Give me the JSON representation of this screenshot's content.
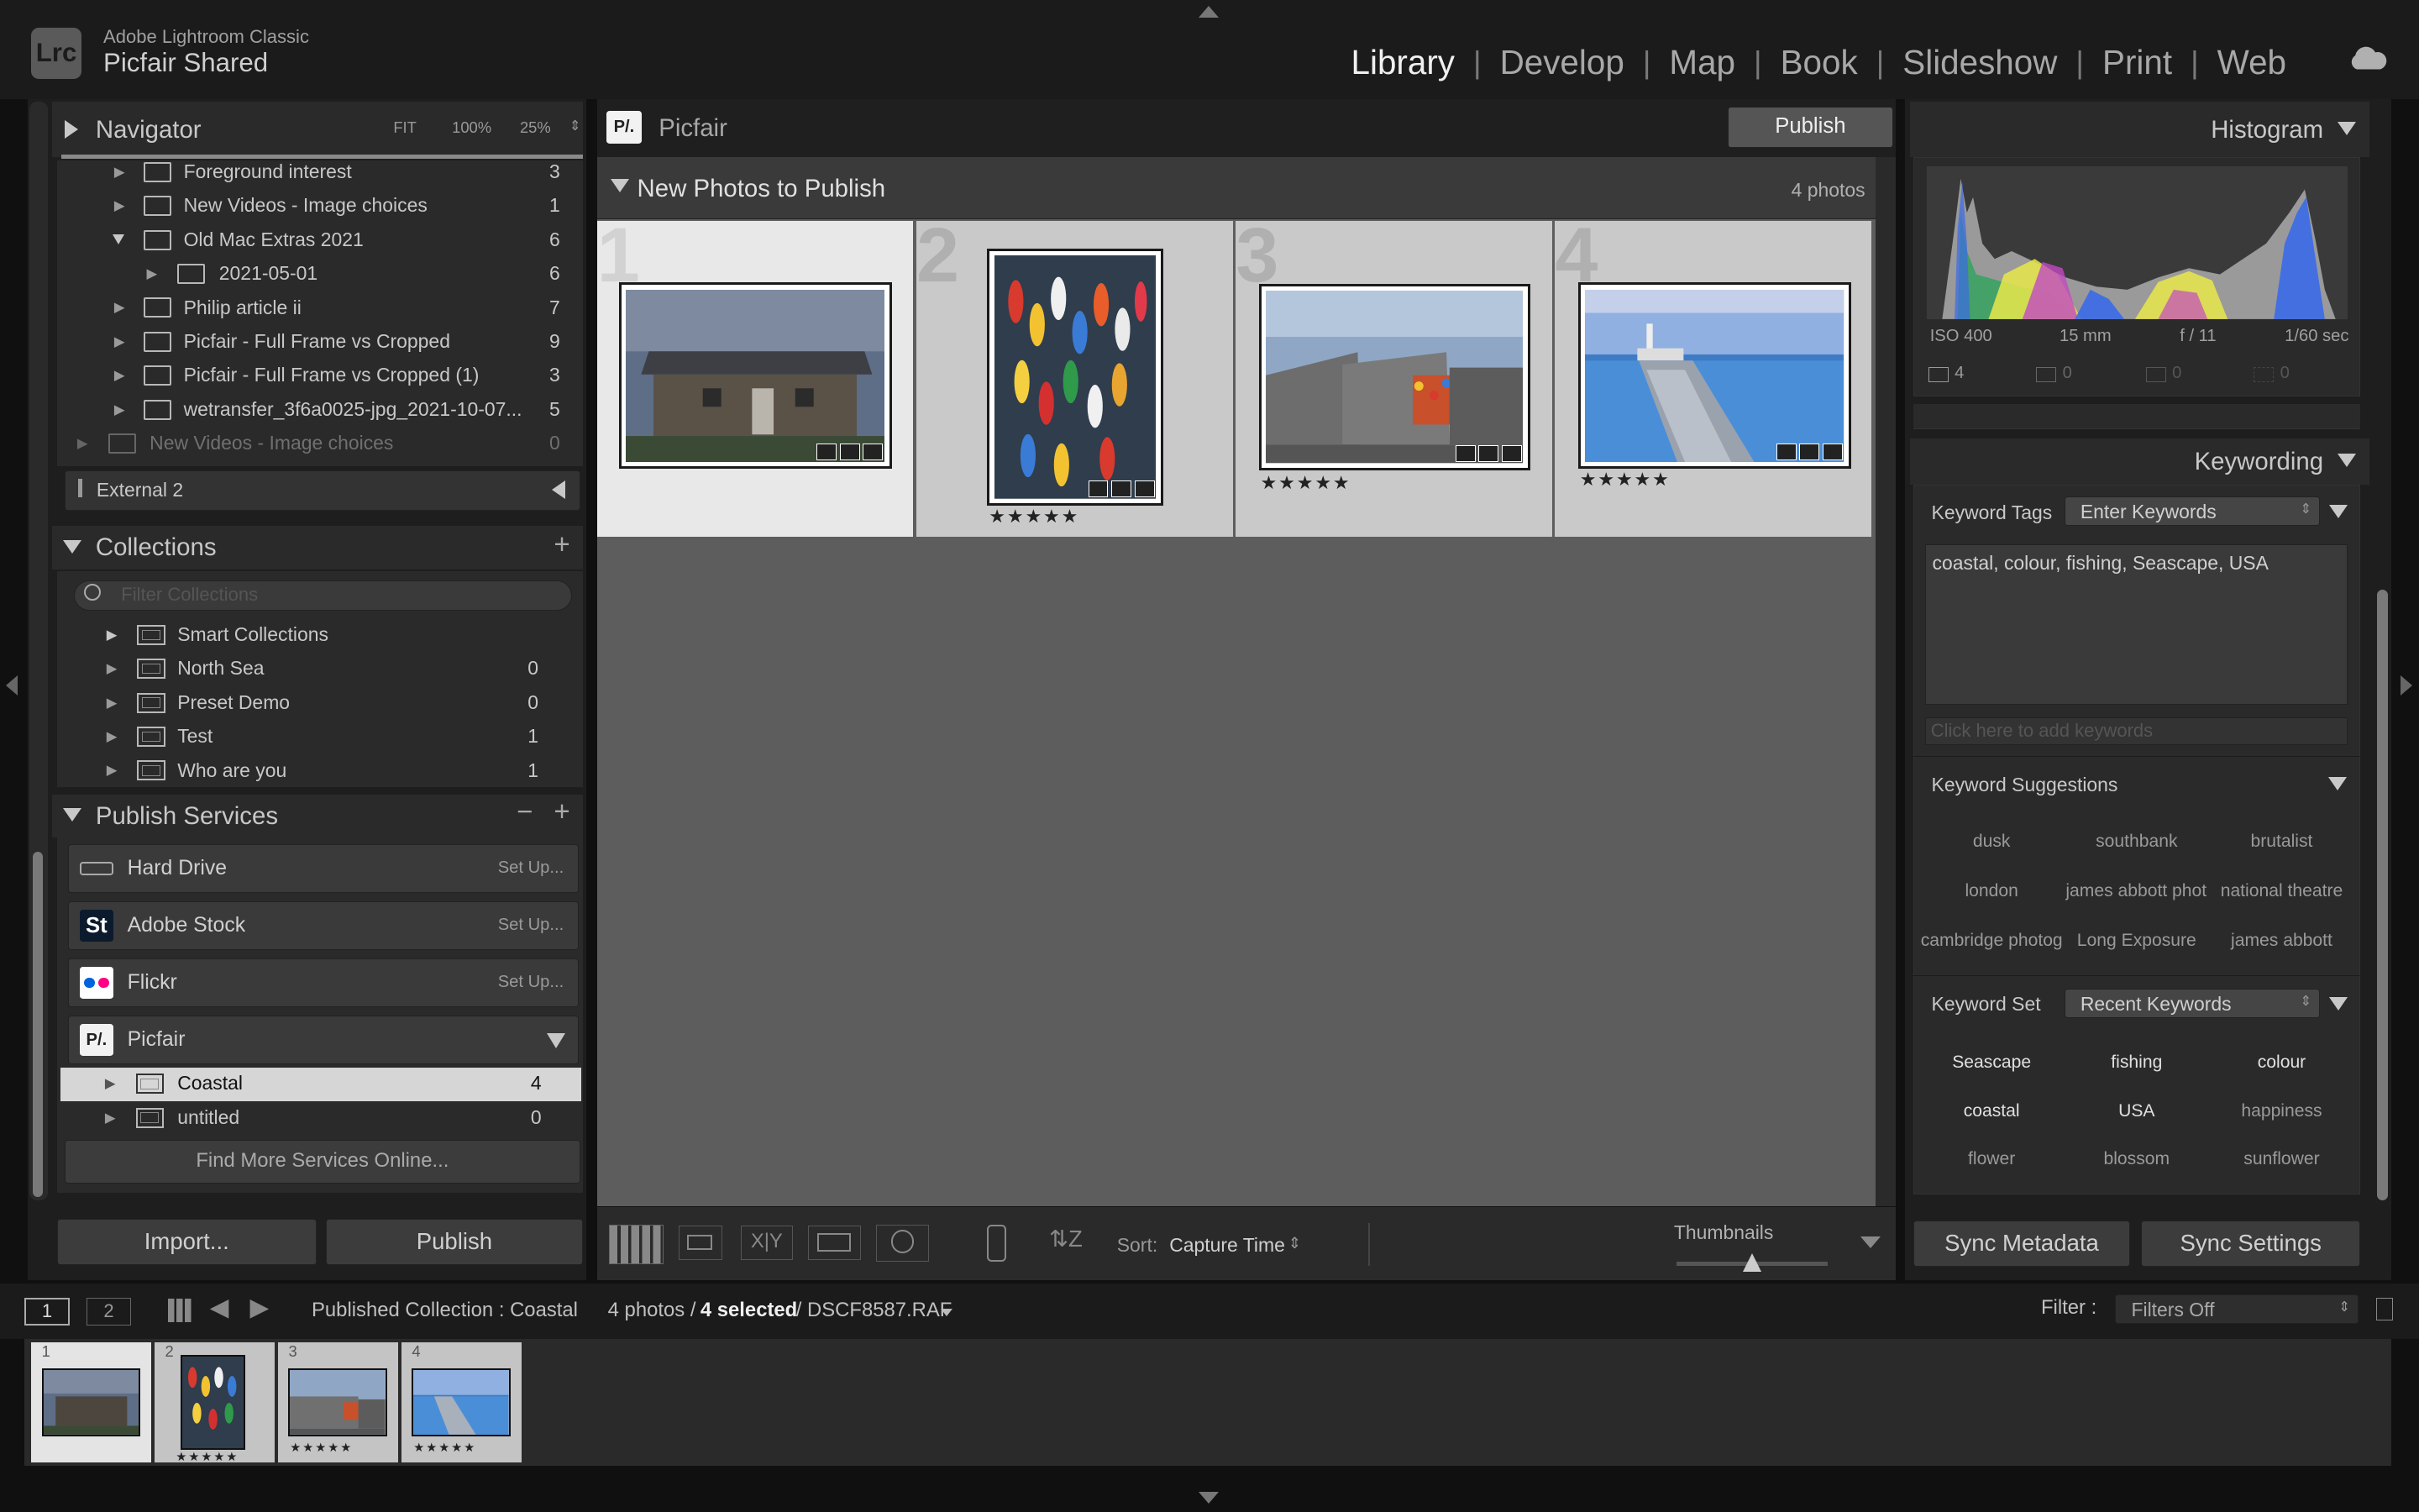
{
  "app": {
    "product": "Adobe Lightroom Classic",
    "catalog": "Picfair Shared",
    "logo": "Lrc"
  },
  "modules": [
    "Library",
    "Develop",
    "Map",
    "Book",
    "Slideshow",
    "Print",
    "Web"
  ],
  "active_module": "Library",
  "navigator": {
    "title": "Navigator",
    "zoom_options": [
      "FIT",
      "100%",
      "25%"
    ]
  },
  "folders": [
    {
      "name": "Foreground interest",
      "count": "3"
    },
    {
      "name": "New Videos - Image choices",
      "count": "1"
    },
    {
      "name": "Old Mac Extras 2021",
      "count": "6"
    },
    {
      "name": "2021-05-01",
      "count": "6"
    },
    {
      "name": "Philip article ii",
      "count": "7"
    },
    {
      "name": "Picfair - Full Frame vs Cropped",
      "count": "9"
    },
    {
      "name": "Picfair - Full Frame vs Cropped (1)",
      "count": "3"
    },
    {
      "name": "wetransfer_3f6a0025-jpg_2021-10-07...",
      "count": "5"
    },
    {
      "name": "New Videos - Image choices",
      "count": "0"
    }
  ],
  "volume": {
    "name": "External 2"
  },
  "collections": {
    "title": "Collections",
    "filter_placeholder": "Filter Collections",
    "items": [
      {
        "name": "Smart Collections",
        "count": ""
      },
      {
        "name": "North Sea",
        "count": "0"
      },
      {
        "name": "Preset Demo",
        "count": "0"
      },
      {
        "name": "Test",
        "count": "1"
      },
      {
        "name": "Who are you",
        "count": "1"
      }
    ]
  },
  "publish_services": {
    "title": "Publish Services",
    "minus": "−",
    "plus": "+",
    "services": [
      {
        "name": "Hard Drive",
        "action": "Set Up..."
      },
      {
        "name": "Adobe Stock",
        "action": "Set Up..."
      },
      {
        "name": "Flickr",
        "action": "Set Up..."
      },
      {
        "name": "Picfair",
        "action": ""
      }
    ],
    "picfair_collections": [
      {
        "name": "Coastal",
        "count": "4"
      },
      {
        "name": "untitled",
        "count": "0"
      }
    ],
    "find_more": "Find More Services Online..."
  },
  "left_buttons": {
    "import": "Import...",
    "publish": "Publish"
  },
  "center": {
    "service_title": "Picfair",
    "publish_button": "Publish",
    "section_title": "New Photos to Publish",
    "section_count": "4 photos",
    "cells": [
      {
        "num": "1",
        "stars": ""
      },
      {
        "num": "2",
        "stars": "★★★★★"
      },
      {
        "num": "3",
        "stars": "★★★★★"
      },
      {
        "num": "4",
        "stars": "★★★★★"
      }
    ]
  },
  "toolbar": {
    "sort_label": "Sort:",
    "sort_value": "Capture Time",
    "thumbnails_label": "Thumbnails",
    "thumbnail_slider": 0.5
  },
  "histogram": {
    "title": "Histogram",
    "iso": "ISO 400",
    "focal": "15 mm",
    "aperture": "f / 11",
    "shutter": "1/60 sec",
    "stats": [
      "4",
      "0",
      "0",
      "0"
    ]
  },
  "keywording": {
    "title": "Keywording",
    "tags_label": "Keyword Tags",
    "tags_mode": "Enter Keywords",
    "tags_text": "coastal, colour, fishing, Seascape, USA",
    "add_placeholder": "Click here to add keywords",
    "suggestions_title": "Keyword Suggestions",
    "suggestions": [
      "dusk",
      "southbank",
      "brutalist",
      "london",
      "james abbott phot...",
      "national theatre",
      "cambridge photog...",
      "Long Exposure",
      "james abbott"
    ],
    "set_label": "Keyword Set",
    "set_value": "Recent Keywords",
    "set_items": [
      {
        "name": "Seascape",
        "active": true
      },
      {
        "name": "fishing",
        "active": true
      },
      {
        "name": "colour",
        "active": true
      },
      {
        "name": "coastal",
        "active": true
      },
      {
        "name": "USA",
        "active": true
      },
      {
        "name": "happiness",
        "active": false
      },
      {
        "name": "flower",
        "active": false
      },
      {
        "name": "blossom",
        "active": false
      },
      {
        "name": "sunflower",
        "active": false
      }
    ]
  },
  "right_buttons": {
    "sync_metadata": "Sync Metadata",
    "sync_settings": "Sync Settings"
  },
  "filmstrip_bar": {
    "screen1": "1",
    "screen2": "2",
    "path": "Published Collection : Coastal",
    "count": "4 photos /",
    "selected": "4 selected",
    "file": "/ DSCF8587.RAF",
    "filter_label": "Filter :",
    "filter_value": "Filters Off"
  },
  "filmstrip": [
    {
      "num": "1",
      "stars": ""
    },
    {
      "num": "2",
      "stars": "★★★★★"
    },
    {
      "num": "3",
      "stars": "★★★★★"
    },
    {
      "num": "4",
      "stars": "★★★★★"
    }
  ]
}
